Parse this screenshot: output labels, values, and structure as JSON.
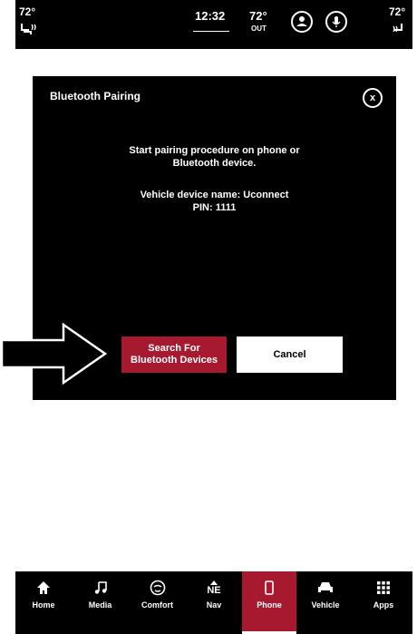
{
  "status_bar": {
    "left_temp": "72°",
    "clock": "12:32",
    "out_temp": "72°",
    "out_label": "OUT",
    "right_temp": "72°"
  },
  "dialog": {
    "title": "Bluetooth Pairing",
    "close_label": "x",
    "instruction_line1": "Start pairing procedure on phone or",
    "instruction_line2": "Bluetooth device.",
    "device_name_line": "Vehicle device name: Uconnect",
    "pin_line": "PIN: 1111",
    "search_label_line1": "Search For",
    "search_label_line2": "Bluetooth Devices",
    "cancel_label": "Cancel"
  },
  "nav": {
    "items": [
      {
        "label": "Home",
        "icon": "home-icon"
      },
      {
        "label": "Media",
        "icon": "music-note-icon"
      },
      {
        "label": "Comfort",
        "icon": "comfort-icon"
      },
      {
        "label": "Nav",
        "icon": "compass-icon"
      },
      {
        "label": "Phone",
        "icon": "phone-icon"
      },
      {
        "label": "Vehicle",
        "icon": "car-icon"
      },
      {
        "label": "Apps",
        "icon": "apps-grid-icon"
      }
    ],
    "compass_heading": "NE",
    "active": "Phone"
  },
  "colors": {
    "accent": "#a6192e",
    "background": "#000000",
    "screen": "#ffffff"
  }
}
